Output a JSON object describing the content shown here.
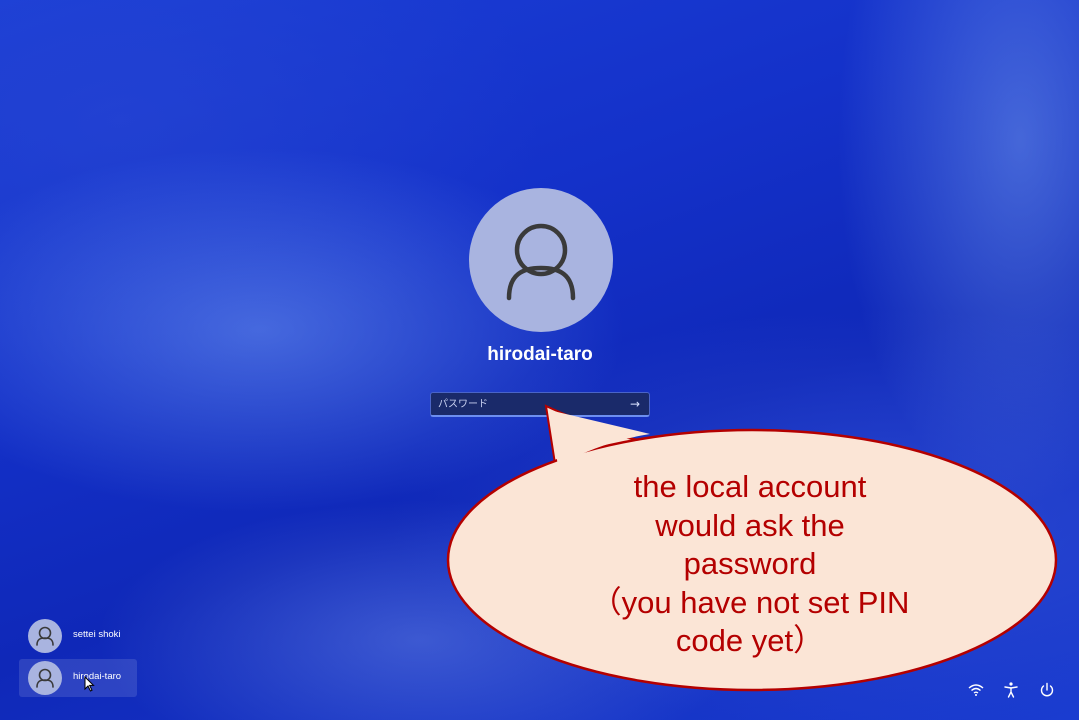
{
  "account": {
    "username": "hirodai-taro",
    "password_placeholder": "パスワード",
    "submit_icon": "arrow-right-icon"
  },
  "callout": {
    "text": "the local account\nwould ask the\npassword\n（you have not set PIN\ncode yet）",
    "fill_color": "#fbe5d6",
    "border_color": "#b40000",
    "text_color": "#b40000"
  },
  "user_list": [
    {
      "name": "settei shoki",
      "selected": false
    },
    {
      "name": "hirodai-taro",
      "selected": true
    }
  ],
  "system_icons": [
    "wifi-icon",
    "accessibility-icon",
    "power-icon"
  ],
  "colors": {
    "background": "#1230c8",
    "avatar": "#a9b4e0"
  }
}
